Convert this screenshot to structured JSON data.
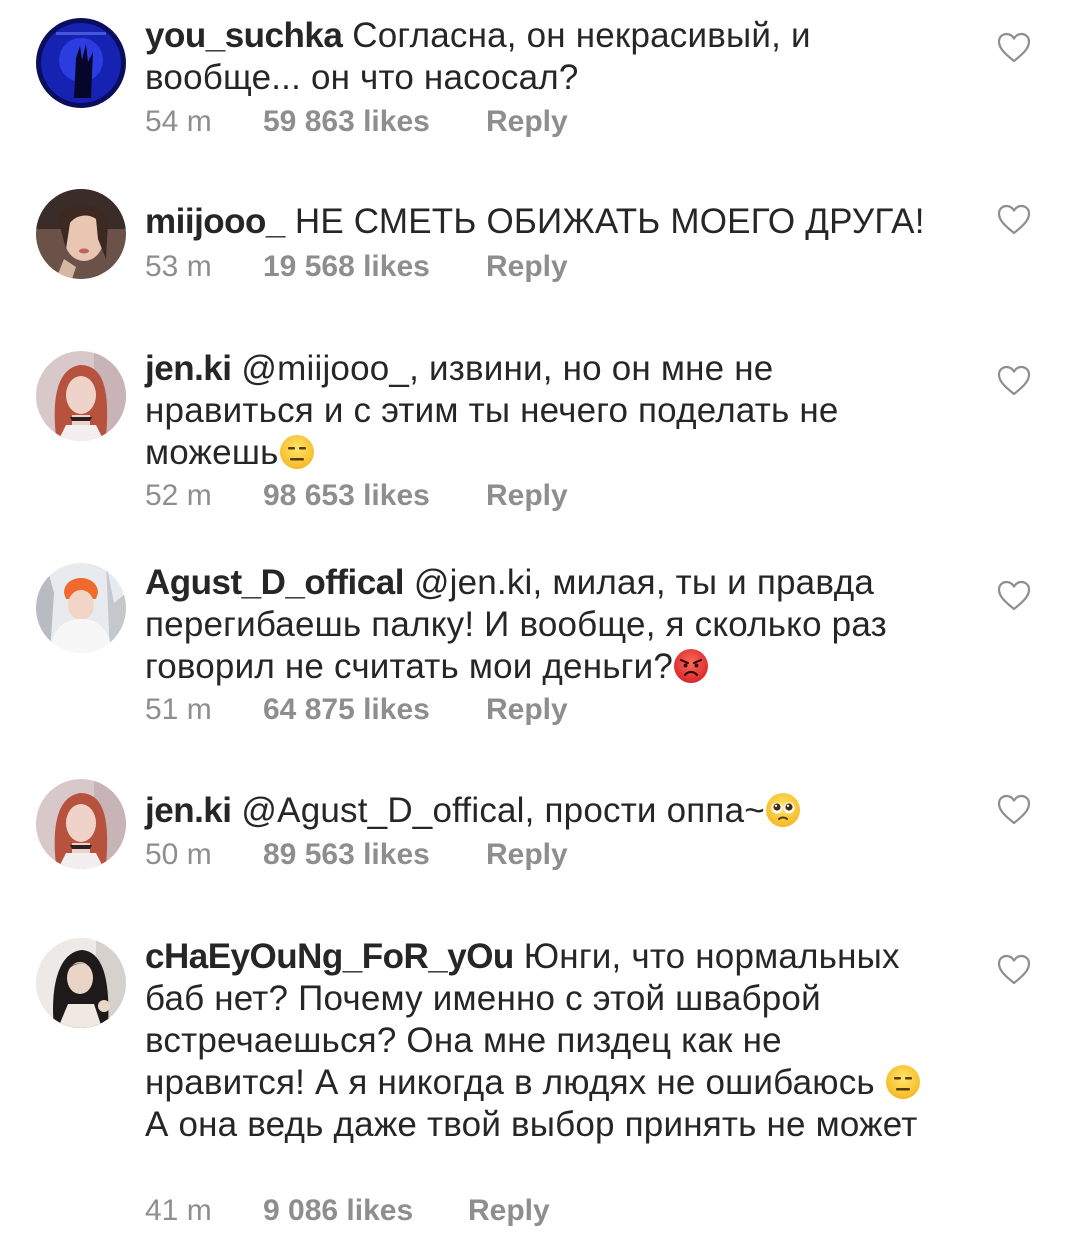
{
  "comments": [
    {
      "username": "you_suchka",
      "text": "Согласна, он некрасивый, и вообще... он что насосал?",
      "emoji": "",
      "text_after": "",
      "time": "54 m",
      "likes": "59 863 likes",
      "reply": "Reply"
    },
    {
      "username": "miijooo_",
      "text": "НЕ СМЕТЬ ОБИЖАТЬ МОЕГО ДРУГА!",
      "emoji": "",
      "text_after": "",
      "time": "53 m",
      "likes": "19 568 likes",
      "reply": "Reply"
    },
    {
      "username": "jen.ki",
      "text": "@miijooo_, извини, но он мне не нравиться и с этим ты нечего поделать не можешь",
      "emoji": "expressionless-face",
      "text_after": "",
      "time": "52 m",
      "likes": "98 653 likes",
      "reply": "Reply"
    },
    {
      "username": "Agust_D_offical",
      "text": "@jen.ki, милая, ты и правда перегибаешь палку! И вообще, я сколько раз говорил не считать мои деньги?",
      "emoji": "angry-face",
      "text_after": "",
      "time": "51 m",
      "likes": "64 875 likes",
      "reply": "Reply"
    },
    {
      "username": "jen.ki",
      "text": "@Agust_D_offical, прости оппа~",
      "emoji": "pleading-face",
      "text_after": "",
      "time": "50 m",
      "likes": "89 563 likes",
      "reply": "Reply"
    },
    {
      "username": "cHaEyOuNg_FoR_yOu",
      "text": "Юнги, что нормальных баб нет? Почему именно с этой шваброй встречаешься? Она мне пиздец как не нравится! А я никогда в людях не ошибаюсь ",
      "emoji": "expressionless-face",
      "text_after": " А она ведь даже твой выбор принять не может",
      "time": "41 m",
      "likes": "9 086 likes",
      "reply": "Reply"
    }
  ],
  "colors": {
    "text": "#262626",
    "secondary": "#8e8e8e",
    "heart_outline": "#8e8e8e",
    "background": "#ffffff"
  },
  "icons": {
    "like": "heart-outline-icon"
  }
}
